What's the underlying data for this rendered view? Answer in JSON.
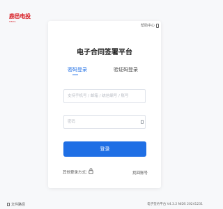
{
  "brand": {
    "logo_text": "鹿邑电投",
    "logo_sub": "HBDG",
    "color": "#d8232a"
  },
  "help": {
    "label": "帮助中心",
    "icon": "book-icon"
  },
  "card": {
    "title": "电子合同签署平台"
  },
  "tabs": [
    {
      "label": "密码登录",
      "active": true
    },
    {
      "label": "验证码登录",
      "active": false
    }
  ],
  "form": {
    "account_placeholder": "支持手机号 / 邮箱 / 统信编号 / 账号",
    "account_value": "",
    "password_placeholder": "密码",
    "password_value": "",
    "login_label": "登录"
  },
  "other_login": {
    "label": "其他登录方式：",
    "icon": "lock-icon"
  },
  "forgot_label": "找回账号",
  "footer": {
    "left_label": "文件路径",
    "right_label": "电子签约平台 V4.3.2 NIDS 20241231"
  },
  "colors": {
    "accent": "#1f6fe5",
    "background": "#f7f8fa"
  }
}
